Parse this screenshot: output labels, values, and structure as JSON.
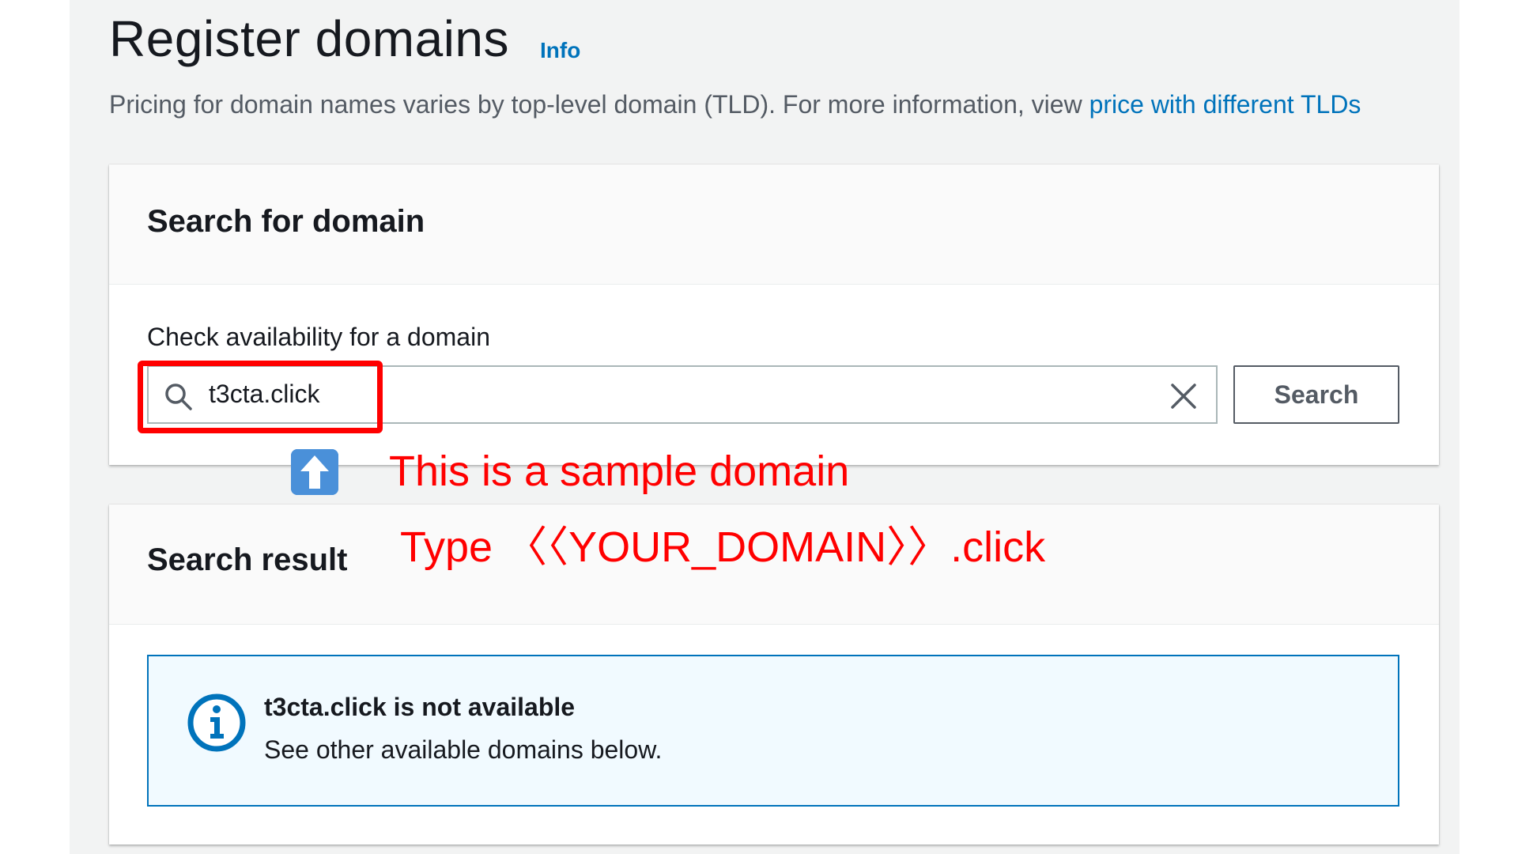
{
  "header": {
    "title": "Register domains",
    "info_link": "Info",
    "description_text": "Pricing for domain names varies by top-level domain (TLD). For more information, view ",
    "description_link": "price with different TLDs"
  },
  "search_panel": {
    "title": "Search for domain",
    "field_label": "Check availability for a domain",
    "input_value": "t3cta.click",
    "search_button": "Search"
  },
  "result_panel": {
    "title": "Search result",
    "alert_title": "t3cta.click is not available",
    "alert_body": "See other available domains below."
  },
  "annotation": {
    "line1": "This is a sample domain",
    "line2": "Type 〈〈YOUR_DOMAIN〉〉.click",
    "arrow_icon": "up-arrow-icon"
  },
  "colors": {
    "link": "#0073bb",
    "annotation": "#ff0000",
    "info_border": "#0073bb",
    "info_bg": "#f1faff"
  }
}
